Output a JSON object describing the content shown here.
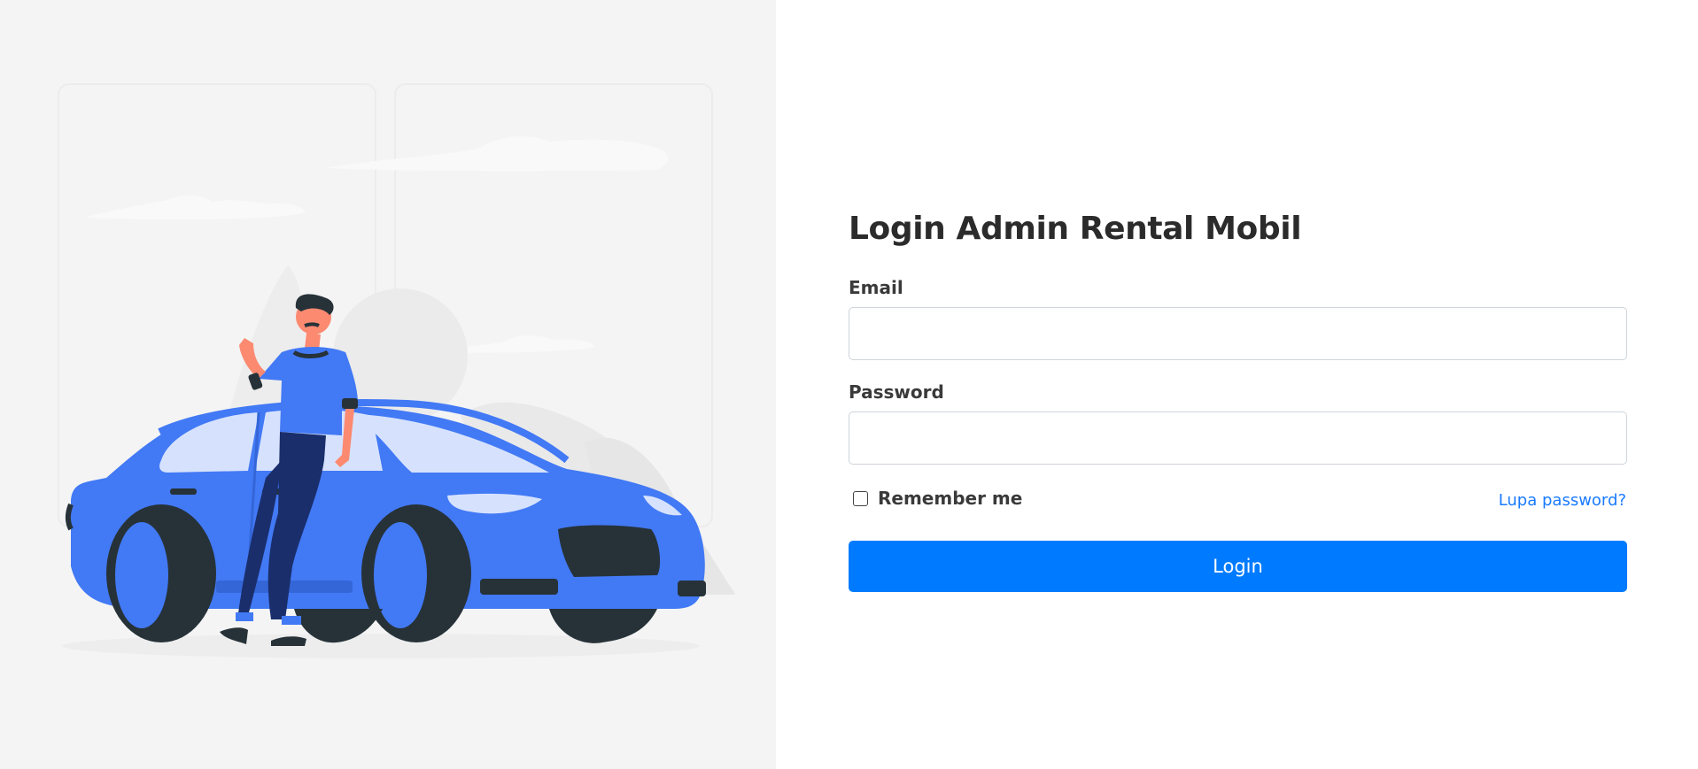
{
  "login_form": {
    "title": "Login Admin Rental Mobil",
    "email_label": "Email",
    "email_value": "",
    "password_label": "Password",
    "password_value": "",
    "remember_label": "Remember me",
    "remember_checked": false,
    "forgot_link": "Lupa password?",
    "submit_label": "Login"
  },
  "illustration": {
    "subject": "man-leaning-on-car",
    "icon": "car-illustration"
  },
  "colors": {
    "panel_background": "#f4f4f4",
    "car_body": "#4279f5",
    "car_tire": "#263238",
    "primary_button": "#007bff",
    "link": "#1a7bff"
  }
}
